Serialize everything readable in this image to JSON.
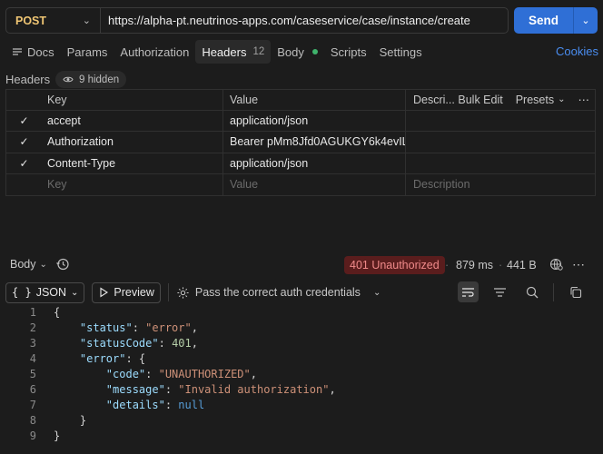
{
  "request": {
    "method": "POST",
    "url": "https://alpha-pt.neutrinos-apps.com/caseservice/case/instance/create",
    "send_label": "Send"
  },
  "tabs": [
    {
      "label": "Docs"
    },
    {
      "label": "Params"
    },
    {
      "label": "Authorization"
    },
    {
      "label": "Headers",
      "count": "12"
    },
    {
      "label": "Body"
    },
    {
      "label": "Scripts"
    },
    {
      "label": "Settings"
    }
  ],
  "cookies_label": "Cookies",
  "headers_section": {
    "label": "Headers",
    "hidden_label": "9 hidden",
    "columns": {
      "key": "Key",
      "value": "Value",
      "description": "Descri...",
      "bulk_edit": "Bulk Edit",
      "presets": "Presets"
    },
    "rows": [
      {
        "key": "accept",
        "value": "application/json"
      },
      {
        "key": "Authorization",
        "value": "Bearer pMm8Jfd0AGUKGY6k4evIL..."
      },
      {
        "key": "Content-Type",
        "value": "application/json"
      }
    ],
    "placeholder": {
      "key": "Key",
      "value": "Value",
      "description": "Description"
    }
  },
  "response": {
    "body_label": "Body",
    "status": "401 Unauthorized",
    "time": "879 ms",
    "size": "441 B",
    "format_label": "JSON",
    "preview_label": "Preview",
    "auth_note": "Pass the correct auth credentials"
  },
  "code_lines": [
    "1",
    "2",
    "3",
    "4",
    "5",
    "6",
    "7",
    "8",
    "9"
  ],
  "code": {
    "status_key": "\"status\"",
    "status_val": "\"error\"",
    "statusCode_key": "\"statusCode\"",
    "statusCode_val": "401",
    "error_key": "\"error\"",
    "code_key": "\"code\"",
    "code_val": "\"UNAUTHORIZED\"",
    "message_key": "\"message\"",
    "message_val": "\"Invalid authorization\"",
    "details_key": "\"details\"",
    "details_val": "null"
  },
  "colors": {
    "send": "#2f6fd6",
    "method": "#f0c674",
    "status_bg": "#5a1d1d",
    "status_text": "#f08a8a",
    "link": "#4a8df0",
    "body_dot": "#3fb36c"
  }
}
